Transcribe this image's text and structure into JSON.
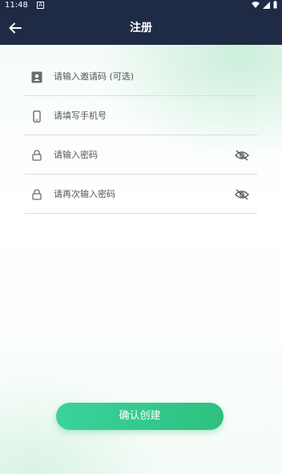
{
  "status_bar": {
    "time": "11:48",
    "notification_glyph": "A"
  },
  "app_bar": {
    "title": "注册",
    "back_icon": "arrow-left-icon"
  },
  "form": {
    "fields": [
      {
        "placeholder": "请输入邀请码 (可选)",
        "icon": "contact-card-icon"
      },
      {
        "placeholder": "请填写手机号",
        "icon": "phone-icon"
      },
      {
        "placeholder": "请输入密码",
        "icon": "lock-icon",
        "trailing_icon": "eye-off-icon"
      },
      {
        "placeholder": "请再次输入密码",
        "icon": "lock-icon",
        "trailing_icon": "eye-off-icon"
      }
    ]
  },
  "submit": {
    "label": "确认创建"
  },
  "colors": {
    "header": "#1f2a44",
    "accent": "#2ec07f"
  }
}
